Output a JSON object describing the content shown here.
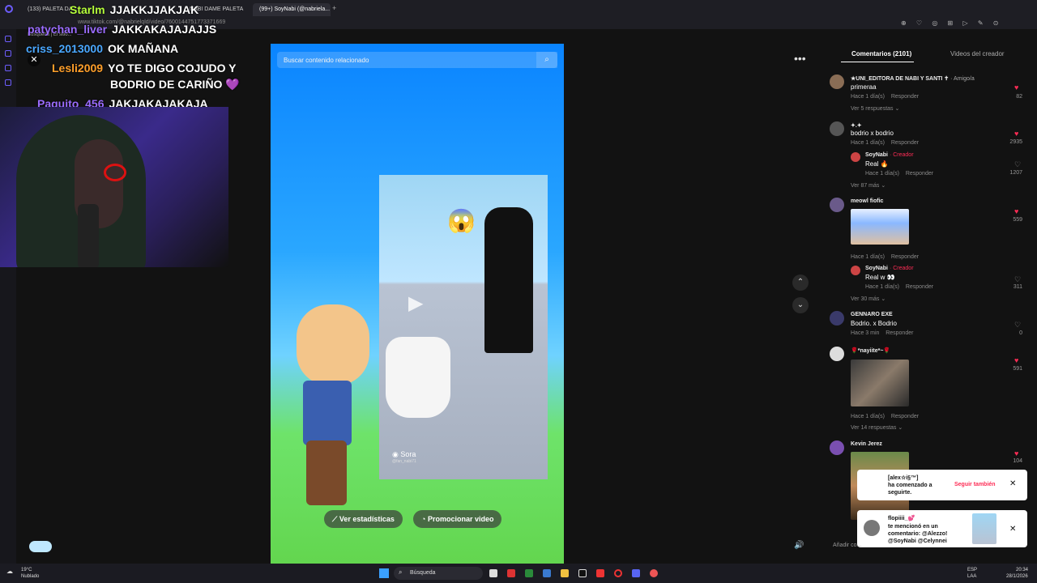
{
  "browser": {
    "tabs": [
      "(133) PALETA DA...",
      "NABI DAME PALETA",
      "(99+) SoyNabi (@nabriela..."
    ],
    "url": "www.tiktok.com/@nabrielqld/video/7600144751773371669",
    "bookmark": "Búsqueda | El sitio..."
  },
  "chat": [
    {
      "user": "Starlm",
      "message": "JJAKKJJAKJAK",
      "user_color": "#b6ff3b"
    },
    {
      "user": "patychan_liver",
      "message": "JAKKAKAJAJAJJS",
      "user_color": "#9b6cff"
    },
    {
      "user": "criss_2013000",
      "message": "OK MAÑANA",
      "user_color": "#4aa8ff"
    },
    {
      "user": "Lesli2009",
      "message": "YO TE DIGO COJUDO Y",
      "message2": "BODRIO DE CARIÑO 💜",
      "user_color": "#ff9f2a"
    },
    {
      "user": "Paquito_456",
      "message": "JAKJAKAJAKAJA",
      "user_color": "#9b6cff"
    }
  ],
  "video": {
    "search_placeholder": "Buscar contenido relacionado",
    "watermark": "Sora",
    "watermark_handle": "@fan_nabi71",
    "emoji": "😱",
    "btn_stats": "Ver estadísticas",
    "btn_promote": "Promocionar video"
  },
  "comments_panel": {
    "tab_comments": "Comentarios (2101)",
    "tab_creator": "Videos del creador",
    "add_comment": "Añadir co...",
    "comments": [
      {
        "user": "★UNI_EDITORA DE NABI Y SANTI ✝",
        "badge": "· Amigo/a",
        "text": "primeraa",
        "meta": "Hace 1 día(s)",
        "reply": "Responder",
        "likes": "82",
        "liked": true,
        "more": "Ver 5 respuestas ⌄"
      },
      {
        "user": "✦.✦",
        "text": "bodrio x bodrio",
        "meta": "Hace 1 día(s)",
        "reply": "Responder",
        "likes": "2935",
        "liked": true
      },
      {
        "user": "SoyNabi",
        "badge": "· Creador",
        "text": "Real 🔥",
        "meta": "Hace 1 día(s)",
        "reply": "Responder",
        "likes": "1207",
        "liked": false,
        "more": "Ver 87 más ⌄"
      },
      {
        "user": "meowl fiofic",
        "text": "",
        "meta": "Hace 1 día(s)",
        "reply": "Responder",
        "likes": "559",
        "liked": true
      },
      {
        "user": "SoyNabi",
        "badge": "· Creador",
        "text": "Real w 👀",
        "meta": "Hace 1 día(s)",
        "reply": "Responder",
        "likes": "311",
        "liked": false,
        "more": "Ver 30 más ⌄"
      },
      {
        "user": "GENNARO EXE",
        "text": "Bodrio. x Bodrio",
        "meta": "Hace 3 min",
        "reply": "Responder",
        "likes": "0",
        "liked": false
      },
      {
        "user": "🌹*nayiite*~🌹",
        "text": "",
        "meta": "Hace 1 día(s)",
        "reply": "Responder",
        "likes": "591",
        "liked": true,
        "more": "Ver 14 respuestas ⌄"
      },
      {
        "user": "Kevin Jerez",
        "text": "",
        "likes": "104",
        "liked": true
      }
    ]
  },
  "notifications": [
    {
      "user": "[alex☆i§™]",
      "text1": "ha comenzado a",
      "text2": "seguirte.",
      "action": "Seguir también"
    },
    {
      "user": "flopiiii_💕",
      "text1": "te mencionó en un",
      "text2": "comentario: @Alezzo!",
      "text3": "@SoyNabi @Celynnei"
    }
  ],
  "taskbar": {
    "weather_temp": "19°C",
    "weather_desc": "Nublado",
    "search": "Búsqueda",
    "lang1": "ESP",
    "lang2": "LAA",
    "time": "20:34",
    "date": "28/1/2026"
  },
  "colors": {
    "accent": "#fe2c55",
    "purple": "#6d5dfc"
  }
}
